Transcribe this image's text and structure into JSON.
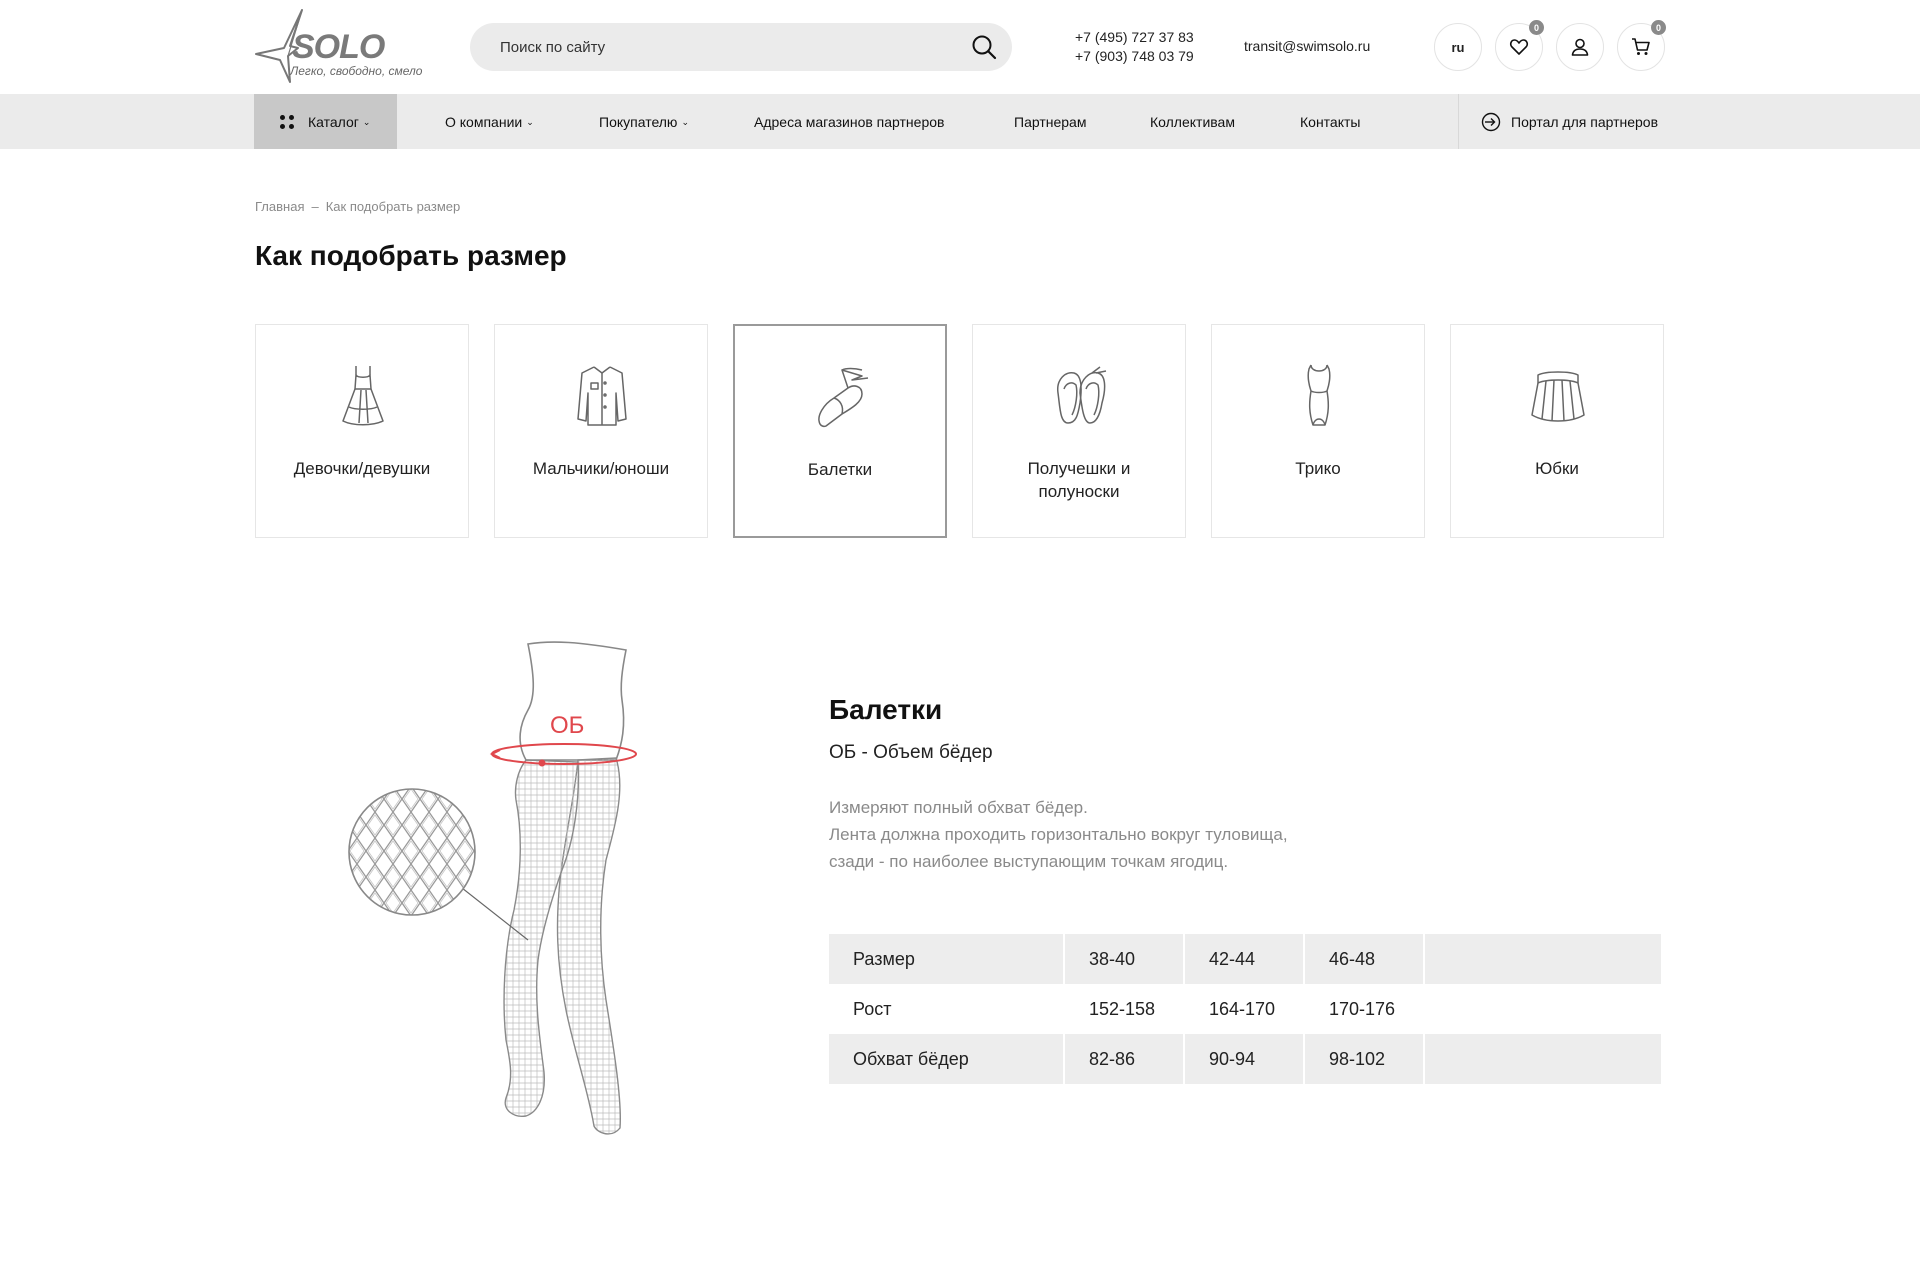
{
  "header": {
    "logo_word": "SOLO",
    "logo_tagline": "Легко, свободно, смело",
    "search_placeholder": "Поиск по сайту",
    "phones": [
      "+7 (495) 727 37 83",
      "+7 (903) 748 03 79"
    ],
    "email": "transit@swimsolo.ru",
    "lang": "ru",
    "favorites_count": "0",
    "cart_count": "0"
  },
  "nav": {
    "catalog": "Каталог",
    "items": [
      "О компании",
      "Покупателю",
      "Адреса магазинов партнеров",
      "Партнерам",
      "Коллективам",
      "Контакты"
    ],
    "portal": "Портал для партнеров"
  },
  "breadcrumb": {
    "home": "Главная",
    "separator": "–",
    "current": "Как подобрать размер"
  },
  "page_title": "Как подобрать размер",
  "categories": [
    {
      "label": "Девочки/девушки",
      "icon": "dress-icon"
    },
    {
      "label": "Мальчики/юноши",
      "icon": "shirt-icon"
    },
    {
      "label": "Балетки",
      "icon": "ballet-shoe-icon",
      "active": true
    },
    {
      "label": "Получешки и полуноски",
      "icon": "half-shoes-icon"
    },
    {
      "label": "Трико",
      "icon": "leotard-icon"
    },
    {
      "label": "Юбки",
      "icon": "skirt-icon"
    }
  ],
  "illustration": {
    "measure_label": "ОБ"
  },
  "detail": {
    "title": "Балетки",
    "subtitle": "ОБ - Объем бёдер",
    "text_lines": [
      "Измеряют полный обхват бёдер.",
      "Лента должна проходить горизонтально вокруг туловища,",
      "сзади - по наиболее выступающим точкам ягодиц."
    ]
  },
  "size_table": {
    "rows": [
      [
        "Размер",
        "38-40",
        "42-44",
        "46-48",
        ""
      ],
      [
        "Рост",
        "152-158",
        "164-170",
        "170-176",
        ""
      ],
      [
        "Обхват бёдер",
        "82-86",
        "90-94",
        "98-102",
        ""
      ]
    ]
  },
  "colors": {
    "accent_red": "#e0474c",
    "nav_bg": "#ebebeb",
    "catalog_bg": "#c8c8c8",
    "table_shade": "#ededed"
  }
}
